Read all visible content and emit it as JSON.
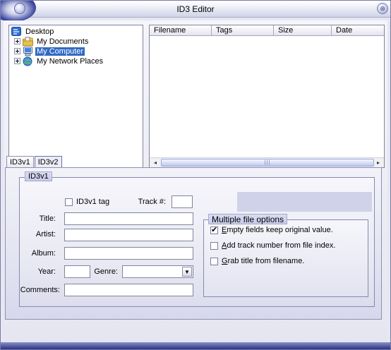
{
  "window": {
    "title": "ID3 Editor",
    "close_glyph": "⊛"
  },
  "tree": {
    "items": [
      {
        "label": "Desktop",
        "icon": "desktop-icon",
        "selected": false
      },
      {
        "label": "My Documents",
        "icon": "folder-documents-icon",
        "selected": false
      },
      {
        "label": "My Computer",
        "icon": "computer-icon",
        "selected": true
      },
      {
        "label": "My Network Places",
        "icon": "network-places-icon",
        "selected": false
      }
    ]
  },
  "file_list": {
    "columns": [
      "Filename",
      "Tags",
      "Size",
      "Date"
    ],
    "scroll_left": "◂",
    "scroll_right": "▸",
    "thumb_grip": "|||"
  },
  "tabs": [
    {
      "label": "ID3v1",
      "active": false
    },
    {
      "label": "ID3v2",
      "active": true
    }
  ],
  "id3v1": {
    "group_title": "ID3v1",
    "tag_checkbox": {
      "label": "ID3v1 tag",
      "checked": false
    },
    "track_label": "Track #:",
    "track_value": "",
    "title_label": "Title:",
    "title_value": "",
    "artist_label": "Artist:",
    "artist_value": "",
    "album_label": "Album:",
    "album_value": "",
    "year_label": "Year:",
    "year_value": "",
    "genre_label": "Genre:",
    "genre_value": "",
    "genre_arrow": "▼",
    "comments_label": "Comments:",
    "comments_value": ""
  },
  "multiple_file_options": {
    "title": "Multiple file options",
    "options": [
      {
        "label_pre": "",
        "label_key": "E",
        "label_rest": "mpty fields keep original value.",
        "checked": true
      },
      {
        "label_pre": "",
        "label_key": "A",
        "label_rest": "dd track number from file index.",
        "checked": false
      },
      {
        "label_pre": "",
        "label_key": "G",
        "label_rest": "rab title from filename.",
        "checked": false
      }
    ]
  },
  "colors": {
    "selection": "#316ac5",
    "frame_dark": "#2a3383",
    "panel_tint": "#e3e4f1"
  }
}
